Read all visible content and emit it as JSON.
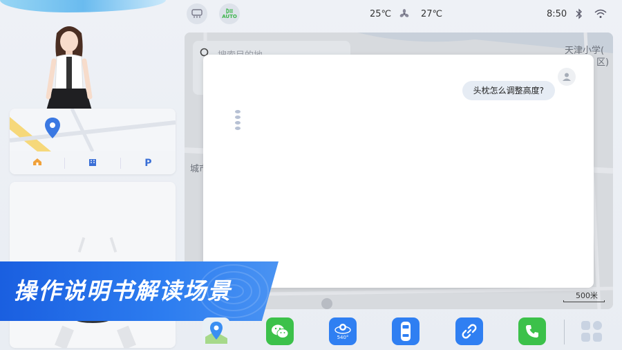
{
  "status_bar": {
    "driver_temp": "25℃",
    "passenger_temp": "27℃",
    "time": "8:50",
    "defrost_icon": "rear-defrost-icon",
    "auto_label": "AUTO",
    "fan_icon": "fan-icon",
    "bluetooth_icon": "bluetooth-icon",
    "wifi_icon": "wifi-icon"
  },
  "nav_card": {
    "shortcuts": [
      {
        "icon": "home-icon",
        "label": ""
      },
      {
        "icon": "company-icon",
        "label": ""
      },
      {
        "icon": "parking-icon",
        "label": "P"
      }
    ]
  },
  "map": {
    "label_school": "天津小学(",
    "label_district": "区)",
    "label_city": "城市",
    "search_placeholder": "搜索目的地",
    "scale_label": "500米"
  },
  "chat": {
    "user_message": "头枕怎么调整高度?"
  },
  "banner": {
    "title": "操作说明书解读场景"
  },
  "dock": {
    "apps": [
      "map-app-icon",
      "wechat-icon",
      "camera-540-icon",
      "car-icon",
      "link-icon",
      "phone-icon",
      "apps-grid-icon"
    ],
    "camera_label": "540°"
  },
  "colors": {
    "banner": "#2d7df0",
    "wechat": "#3cc14a",
    "phone": "#3cc14a",
    "blue_app": "#2f7ff2"
  }
}
